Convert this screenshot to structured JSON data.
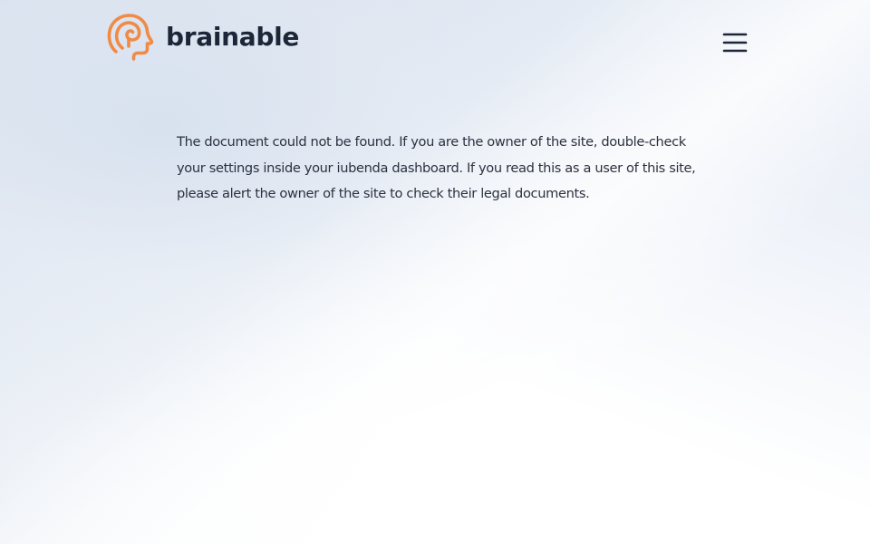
{
  "header": {
    "brand_name": "brainable",
    "logo_icon": "head-profile-icon",
    "menu_icon": "hamburger-menu-icon"
  },
  "main": {
    "message": "The document could not be found. If you are the owner of the site, double-check your settings inside your iubenda dashboard. If you read this as a user of this site, please alert the owner of the site to check their legal documents."
  },
  "colors": {
    "brand_orange": "#f08a45",
    "text_dark": "#1c2638",
    "body_text": "#2b3140",
    "background_tint": "#e3e9f3"
  }
}
